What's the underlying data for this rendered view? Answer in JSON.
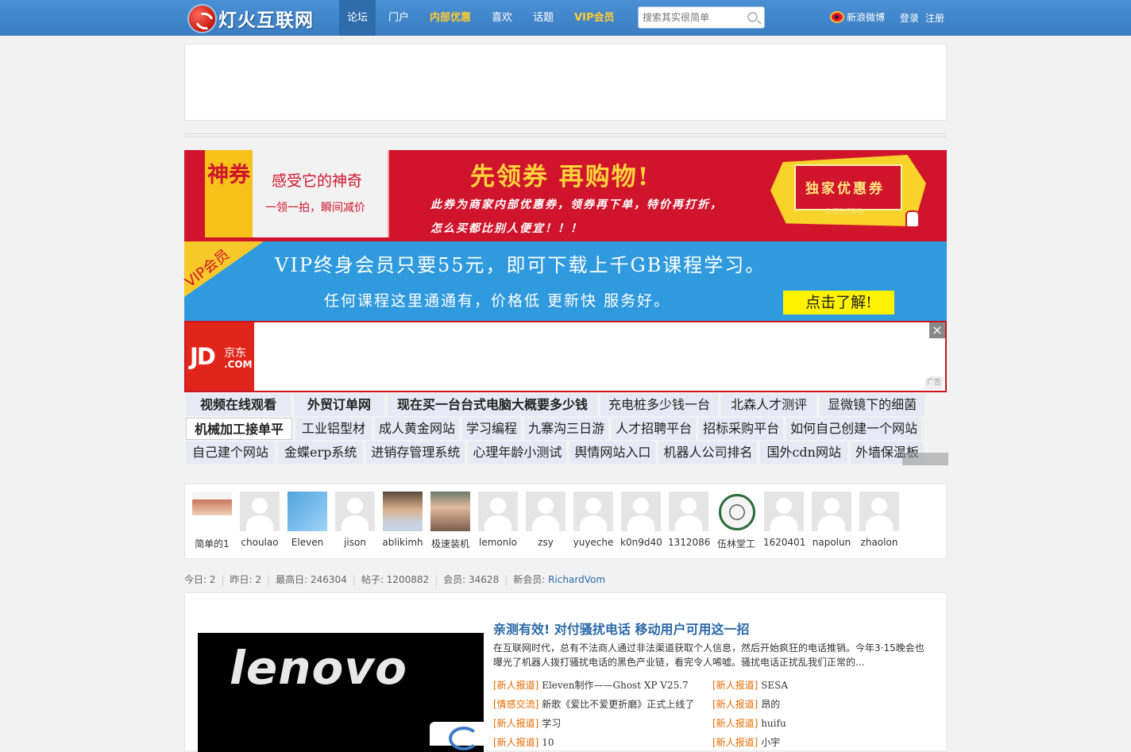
{
  "site": {
    "title": "灯火互联网"
  },
  "nav": [
    {
      "label": "论坛",
      "active": true
    },
    {
      "label": "门户"
    },
    {
      "label": "内部优惠",
      "highlight": true
    },
    {
      "label": "喜欢"
    },
    {
      "label": "话题"
    },
    {
      "label": "VIP会员",
      "highlight": true
    }
  ],
  "search": {
    "placeholder": "搜索其实很简单"
  },
  "header": {
    "weibo": "新浪微博",
    "login": "登录",
    "register": "注册"
  },
  "banner1": {
    "badge": "神券",
    "title": "感受它的神奇",
    "subtitle": "一领一拍，瞬间减价",
    "headline": "先领券  再购物!",
    "line1": "此券为商家内部优惠券，领券再下单，特价再打折，",
    "line2": "怎么买都比别人便宜！！！",
    "coupon": "独家优惠券",
    "coupon_sub": "先领券后购物"
  },
  "banner2": {
    "corner": "VIP会员",
    "line1": "VIP终身会员只要55元，即可下载上千GB课程学习。",
    "line2": "任何课程这里通通有，价格低 更新快 服务好。",
    "button": "点击了解!"
  },
  "jd_ad": {
    "logo": "JD",
    "logo_cn": "京东",
    "logo_com": ".COM",
    "close": "×",
    "ad_tag": "广告"
  },
  "link_rows": [
    [
      "视频在线观看",
      "外贸订单网",
      "现在买一台台式电脑大概要多少钱",
      "充电桩多少钱一台",
      "北森人才测评",
      "显微镜下的细菌"
    ],
    [
      "机械加工接单平",
      "工业铝型材",
      "成人黄金网站",
      "学习编程",
      "九寨沟三日游",
      "人才招聘平台",
      "招标采购平台",
      "如何自己创建一个网站"
    ],
    [
      "自己建个网站",
      "金蝶erp系统",
      "进销存管理系统",
      "心理年龄小测试",
      "舆情网站入口",
      "机器人公司排名",
      "国外cdn网站",
      "外墙保温板"
    ]
  ],
  "members": [
    "简单的1",
    "choulao",
    "Eleven",
    "jison",
    "ablikimh",
    "极速装机",
    "lemonlo",
    "zsy",
    "yuyeche",
    "k0n9d40",
    "1312086",
    "伍林堂工",
    "1620401",
    "napolun",
    "zhaolon"
  ],
  "stats": {
    "today": "今日: 2",
    "yesterday": "昨日: 2",
    "max": "最高日: 246304",
    "posts": "帖子: 1200882",
    "members": "会员: 34628",
    "newmember_label": "新会员: ",
    "newmember": "RichardVom"
  },
  "feature": {
    "image_text": "lenovo",
    "headline": "亲测有效! 对付骚扰电话 移动用户可用这一招",
    "summary": "在互联网时代，总有不法商人通过非法渠道获取个人信息，然后开始疯狂的电话推销。今年3·15晚会也曝光了机器人拨打骚扰电话的黑色产业链，看完令人唏嘘。骚扰电话正扰乱我们正常的..."
  },
  "posts": [
    {
      "tag": "[新人报道]",
      "title": "Eleven制作——Ghost XP V25.7"
    },
    {
      "tag": "[新人报道]",
      "title": "SESA"
    },
    {
      "tag": "[情感交流]",
      "title": "新歌《爱比不爱更折磨》正式上线了"
    },
    {
      "tag": "[新人报道]",
      "title": "昂的"
    },
    {
      "tag": "[新人报道]",
      "title": "学习"
    },
    {
      "tag": "[新人报道]",
      "title": "huifu"
    },
    {
      "tag": "[新人报道]",
      "title": "10"
    },
    {
      "tag": "[新人报道]",
      "title": "小宇"
    }
  ]
}
